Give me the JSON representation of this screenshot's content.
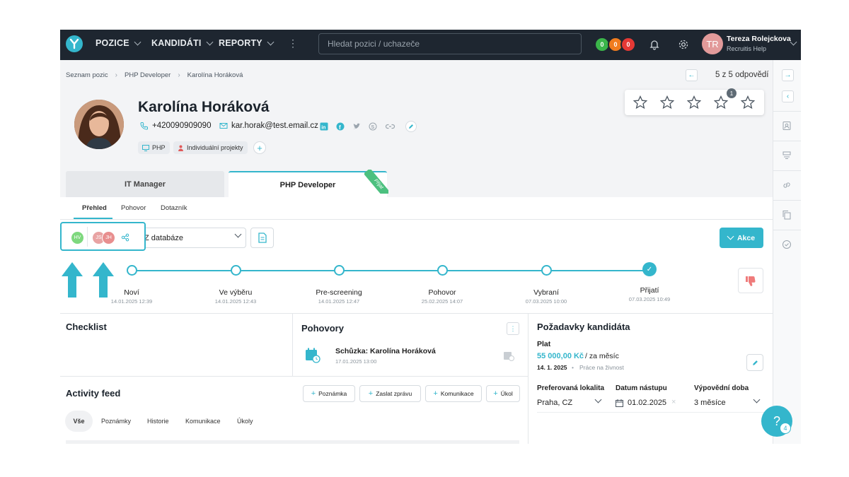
{
  "nav": {
    "items": [
      {
        "label": "POZICE"
      },
      {
        "label": "KANDIDÁTI"
      },
      {
        "label": "REPORTY"
      }
    ],
    "search_placeholder": "Hledat pozici / uchazeče",
    "badges": [
      {
        "value": "0",
        "color": "#3bb54a"
      },
      {
        "value": "0",
        "color": "#f07c1e"
      },
      {
        "value": "0",
        "color": "#e53935"
      }
    ],
    "user": {
      "initials": "TR",
      "name": "Tereza Rolejckova",
      "subtitle": "Recruitis Help"
    }
  },
  "breadcrumb": [
    "Seznam pozic",
    "PHP Developer",
    "Karolína Horáková"
  ],
  "pager": {
    "text": "5 z 5 odpovědí"
  },
  "candidate": {
    "name": "Karolína Horáková",
    "phone": "+420090909090",
    "email": "kar.horak@test.email.cz",
    "tags": [
      "PHP",
      "Individuální projekty"
    ],
    "rating_badge": "1"
  },
  "position_tabs": [
    {
      "label": "IT Manager"
    },
    {
      "label": "PHP Developer",
      "ribbon": "Přijat"
    }
  ],
  "sub_tabs": [
    "Přehled",
    "Pohovor",
    "Dotazník"
  ],
  "toolbar": {
    "recruiters": [
      "HV",
      "JS",
      "JH"
    ],
    "source_select": "Z databáze",
    "action_label": "Akce"
  },
  "pipeline": [
    {
      "label": "Noví",
      "date": "14.01.2025 12:39"
    },
    {
      "label": "Ve výběru",
      "date": "14.01.2025 12:43"
    },
    {
      "label": "Pre-screening",
      "date": "14.01.2025 12:47"
    },
    {
      "label": "Pohovor",
      "date": "25.02.2025 14:07"
    },
    {
      "label": "Vybraní",
      "date": "07.03.2025 10:00"
    },
    {
      "label": "Přijatí",
      "date": "07.03.2025 10:49"
    }
  ],
  "checklist": {
    "title": "Checklist"
  },
  "interviews": {
    "title": "Pohovory",
    "meeting_title": "Schůzka: Karolína Horáková",
    "meeting_date": "17.01.2025 13:00"
  },
  "activity": {
    "title": "Activity feed",
    "buttons": [
      "Poznámka",
      "Zaslat zprávu",
      "Komunikace",
      "Úkol"
    ],
    "tabs": [
      "Vše",
      "Poznámky",
      "Historie",
      "Komunikace",
      "Úkoly"
    ]
  },
  "requirements": {
    "title": "Požadavky kandidáta",
    "salary_label": "Plat",
    "salary_value": "55 000,00 Kč",
    "salary_period": "/ za měsíc",
    "salary_date": "14. 1. 2025",
    "salary_note": "Práce na živnost",
    "location_label": "Preferovaná lokalita",
    "location_value": "Praha, CZ",
    "start_label": "Datum nástupu",
    "start_value": "01.02.2025",
    "notice_label": "Výpovědní doba",
    "notice_value": "3 měsíce"
  },
  "help": {
    "icon": "?",
    "badge": "4"
  },
  "colors": {
    "accent": "#34b6cc",
    "nav_bg": "#1e2630",
    "salary": "#34b6cc"
  }
}
